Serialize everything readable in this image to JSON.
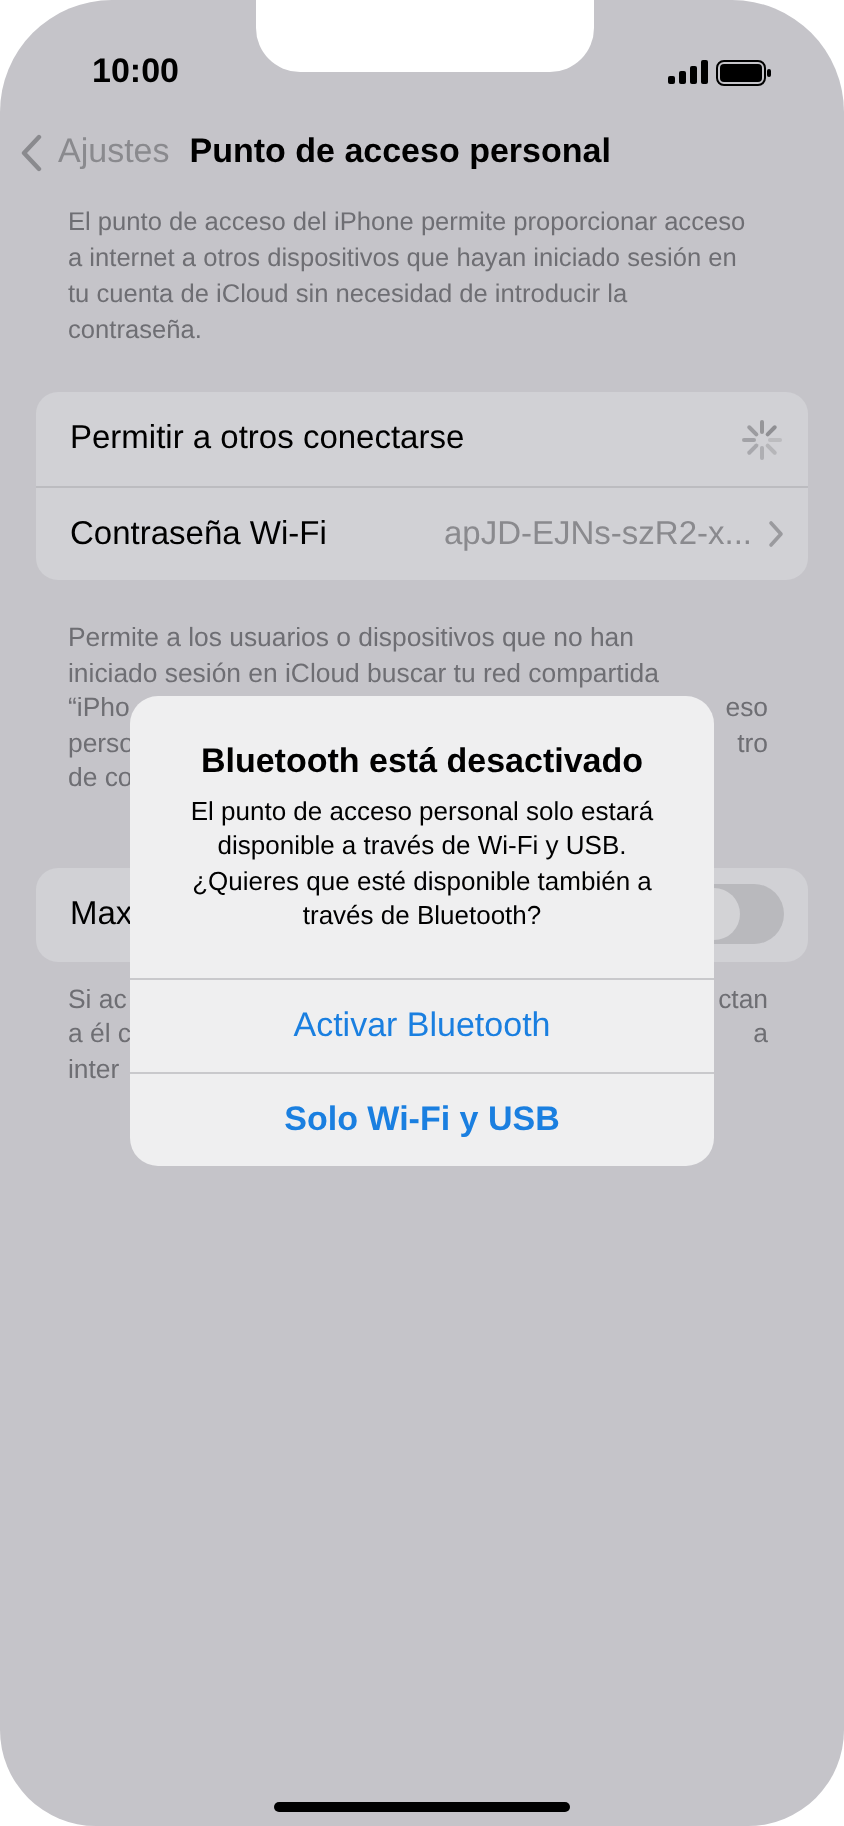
{
  "status_bar": {
    "time": "10:00"
  },
  "nav": {
    "back_label": "Ajustes",
    "title": "Punto de acceso personal"
  },
  "description": "El punto de acceso del iPhone permite proporcionar acceso a internet a otros dispositivos que hayan iniciado sesión en tu cuenta de iCloud sin necesidad de introducir la contraseña.",
  "settings_group": [
    {
      "kind": "spinner",
      "label": "Permitir a otros conectarse"
    },
    {
      "kind": "link",
      "label": "Contraseña Wi-Fi",
      "value": "apJD-EJNs-szR2-x..."
    }
  ],
  "footer_lines": [
    {
      "left": "Permite a los usuarios o dispositivos que no han"
    },
    {
      "left": "iniciado sesión en iCloud buscar tu red compartida"
    },
    {
      "left": "“iPho",
      "right": "eso"
    },
    {
      "left": "perso",
      "right": "tro"
    },
    {
      "left": "de co"
    }
  ],
  "toggle_group": [
    {
      "kind": "toggle",
      "label": "Max",
      "on": false
    }
  ],
  "footer2_lines": [
    {
      "left": "Si ac",
      "right": "ctan"
    },
    {
      "left": "a él c",
      "right": "a"
    },
    {
      "left": "inter"
    }
  ],
  "alert": {
    "title": "Bluetooth está desactivado",
    "message": "El punto de acceso personal solo estará disponible a través de Wi-Fi y USB. ¿Quieres que esté disponible también a través de Bluetooth?",
    "actions": [
      {
        "label": "Activar Bluetooth",
        "preferred": false
      },
      {
        "label": "Solo Wi-Fi y USB",
        "preferred": true
      }
    ]
  }
}
